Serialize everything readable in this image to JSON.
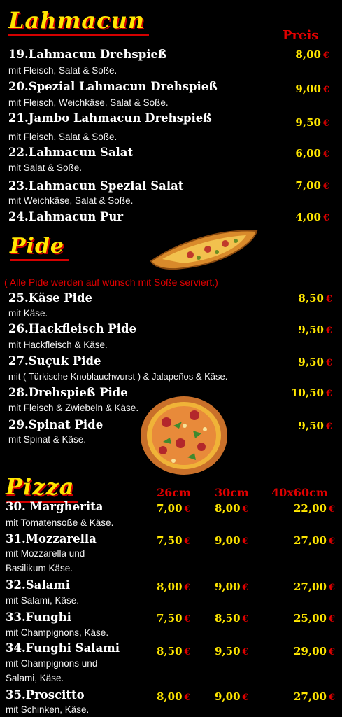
{
  "lahmacun": {
    "title": "Lahmacun",
    "price_header": "Preis",
    "items": [
      {
        "name": "19.Lahmacun Drehspieß",
        "desc": "mit Fleisch, Salat & Soße.",
        "price": "8,00"
      },
      {
        "name": "20.Spezial Lahmacun Drehspieß",
        "desc": "mit Fleisch, Weichkäse, Salat & Soße.",
        "price": "9,00"
      },
      {
        "name": "21.Jambo Lahmacun Drehspieß",
        "desc": "mit Fleisch, Salat & Soße.",
        "price": "9,50"
      },
      {
        "name": "22.Lahmacun Salat",
        "desc": "mit Salat & Soße.",
        "price": "6,00"
      },
      {
        "name": "23.Lahmacun Spezial Salat",
        "desc": "mit Weichkäse, Salat & Soße.",
        "price": "7,00"
      },
      {
        "name": "24.Lahmacun Pur",
        "desc": "",
        "price": "4,00"
      }
    ]
  },
  "pide": {
    "title": "Pide",
    "note": "( Alle Pide werden auf wünsch mit Soße serviert.)",
    "items": [
      {
        "name": "25.Käse Pide",
        "desc": "mit Käse.",
        "price": "8,50"
      },
      {
        "name": "26.Hackfleisch Pide",
        "desc": "mit Hackfleisch & Käse.",
        "price": "9,50"
      },
      {
        "name": "27.Suçuk Pide",
        "desc": "mit ( Türkische Knoblauchwurst ) & Jalapeños & Käse.",
        "price": "9,50"
      },
      {
        "name": "28.Drehspieß Pide",
        "desc": "mit Fleisch & Zwiebeln & Käse.",
        "price": "10,50"
      },
      {
        "name": "29.Spinat Pide",
        "desc": "mit Spinat & Käse.",
        "price": "9,50"
      }
    ]
  },
  "pizza": {
    "title": "Pizza",
    "sizes": [
      "26cm",
      "30cm",
      "40x60cm"
    ],
    "items": [
      {
        "name": "30. Margherita",
        "desc1": "mit Tomatensoße & Käse.",
        "desc2": "",
        "prices": [
          "7,00",
          "8,00",
          "22,00"
        ]
      },
      {
        "name": "31.Mozzarella",
        "desc1": "mit Mozzarella und",
        "desc2": "Basilikum Käse.",
        "prices": [
          "7,50",
          "9,00",
          "27,00"
        ]
      },
      {
        "name": "32.Salami",
        "desc1": "mit Salami, Käse.",
        "desc2": "",
        "prices": [
          "8,00",
          "9,00",
          "27,00"
        ]
      },
      {
        "name": "33.Funghi",
        "desc1": "mit Champignons, Käse.",
        "desc2": "",
        "prices": [
          "7,50",
          "8,50",
          "25,00"
        ]
      },
      {
        "name": "34.Funghi Salami",
        "desc1": "mit Champignons und",
        "desc2": "Salami, Käse.",
        "prices": [
          "8,50",
          "9,50",
          "29,00"
        ]
      },
      {
        "name": "35.Proscitto",
        "desc1": "mit Schinken, Käse.",
        "desc2": "",
        "prices": [
          "8,00",
          "9,00",
          "27,00"
        ]
      }
    ]
  },
  "currency": "€",
  "colors": {
    "background": "#000000",
    "title_yellow": "#ffe600",
    "accent_red": "#e00000",
    "text": "#ffffff"
  },
  "icons": [
    "pide-illustration",
    "pizza-illustration"
  ]
}
